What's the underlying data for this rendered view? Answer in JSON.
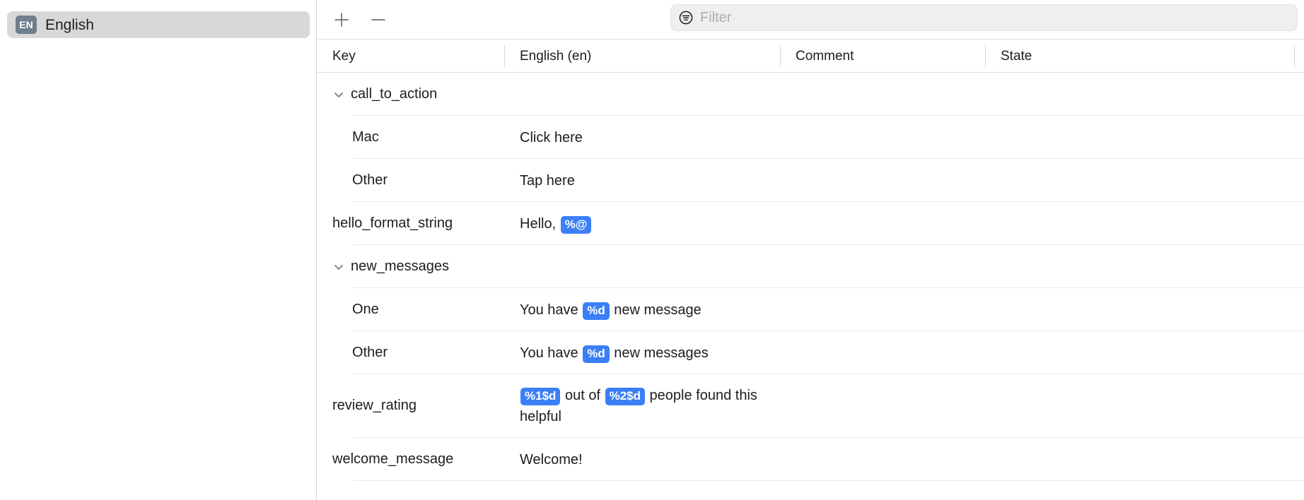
{
  "sidebar": {
    "selected_item": {
      "badge": "EN",
      "label": "English",
      "badge_color": "#6e7f8d",
      "selected_background": "#d8d8d8"
    }
  },
  "toolbar": {
    "add_button_label": "+",
    "add_button_icon": "plus-icon",
    "remove_button_label": "−",
    "remove_button_icon": "minus-icon",
    "filter": {
      "icon": "filter-icon",
      "placeholder": "Filter",
      "value": ""
    }
  },
  "table": {
    "columns": [
      {
        "key": "key",
        "label": "Key"
      },
      {
        "key": "value",
        "label": "English (en)"
      },
      {
        "key": "comment",
        "label": "Comment"
      },
      {
        "key": "state",
        "label": "State"
      }
    ],
    "accent_token_color": "#3b7ff6",
    "rows": [
      {
        "type": "group",
        "expanded": true,
        "disclosure_icon": "chevron-down-icon",
        "key": "call_to_action",
        "segments": [],
        "comment": "",
        "state": ""
      },
      {
        "type": "child",
        "key": "Mac",
        "segments": [
          {
            "kind": "text",
            "text": "Click here"
          }
        ],
        "comment": "",
        "state": ""
      },
      {
        "type": "child",
        "key": "Other",
        "segments": [
          {
            "kind": "text",
            "text": "Tap here"
          }
        ],
        "comment": "",
        "state": ""
      },
      {
        "type": "item",
        "key": "hello_format_string",
        "segments": [
          {
            "kind": "text",
            "text": "Hello, "
          },
          {
            "kind": "token",
            "text": "%@"
          }
        ],
        "comment": "",
        "state": ""
      },
      {
        "type": "group",
        "expanded": true,
        "disclosure_icon": "chevron-down-icon",
        "key": "new_messages",
        "segments": [],
        "comment": "",
        "state": ""
      },
      {
        "type": "child",
        "key": "One",
        "segments": [
          {
            "kind": "text",
            "text": "You have "
          },
          {
            "kind": "token",
            "text": "%d"
          },
          {
            "kind": "text",
            "text": " new message"
          }
        ],
        "comment": "",
        "state": ""
      },
      {
        "type": "child",
        "key": "Other",
        "segments": [
          {
            "kind": "text",
            "text": "You have "
          },
          {
            "kind": "token",
            "text": "%d"
          },
          {
            "kind": "text",
            "text": " new messages"
          }
        ],
        "comment": "",
        "state": ""
      },
      {
        "type": "item",
        "tall": true,
        "key": "review_rating",
        "segments": [
          {
            "kind": "token",
            "text": "%1$d"
          },
          {
            "kind": "text",
            "text": " out of "
          },
          {
            "kind": "token",
            "text": "%2$d"
          },
          {
            "kind": "text",
            "text": " people found this helpful"
          }
        ],
        "comment": "",
        "state": ""
      },
      {
        "type": "item",
        "key": "welcome_message",
        "segments": [
          {
            "kind": "text",
            "text": "Welcome!"
          }
        ],
        "comment": "",
        "state": ""
      }
    ]
  }
}
